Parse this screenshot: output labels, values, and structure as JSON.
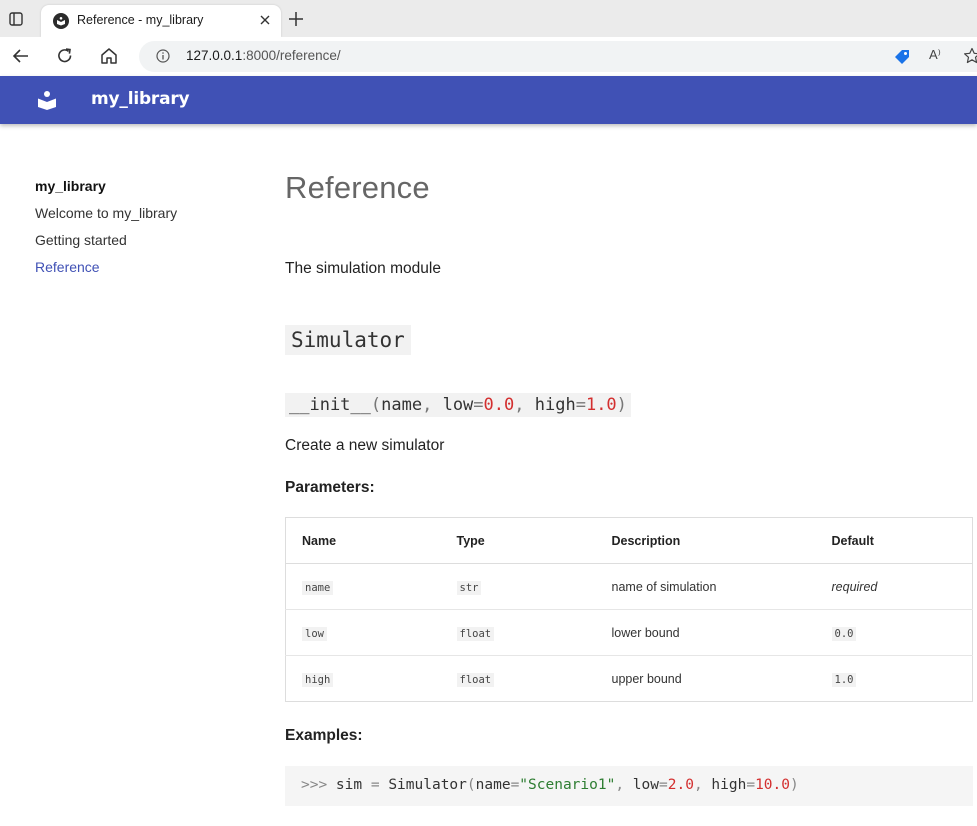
{
  "browser": {
    "tab_title": "Reference - my_library",
    "url_host": "127.0.0.1",
    "url_rest": ":8000/reference/",
    "read_aloud_label": "A⁾"
  },
  "site": {
    "brand": "my_library",
    "accent_color": "#4051b5"
  },
  "nav": {
    "title": "my_library",
    "items": [
      {
        "label": "Welcome to my_library",
        "active": false
      },
      {
        "label": "Getting started",
        "active": false
      },
      {
        "label": "Reference",
        "active": true
      }
    ]
  },
  "content": {
    "heading": "Reference",
    "lead": "The simulation module",
    "class_name": "Simulator",
    "signature": {
      "func": "__init__",
      "open": "(",
      "arg1": "name",
      "sep1": ", ",
      "arg2": "low",
      "eq": "=",
      "val2": "0.0",
      "sep2": ", ",
      "arg3": "high",
      "val3": "1.0",
      "close": ")"
    },
    "description": "Create a new simulator",
    "parameters_heading": "Parameters:",
    "table": {
      "headers": [
        "Name",
        "Type",
        "Description",
        "Default"
      ],
      "rows": [
        {
          "name": "name",
          "type": "str",
          "description": "name of simulation",
          "default": "required"
        },
        {
          "name": "low",
          "type": "float",
          "description": "lower bound",
          "default": "0.0"
        },
        {
          "name": "high",
          "type": "float",
          "description": "upper bound",
          "default": "1.0"
        }
      ]
    },
    "examples_heading": "Examples:",
    "example": {
      "prompt": ">>>",
      "var": " sim ",
      "eq": "=",
      "call": " Simulator",
      "open": "(",
      "k1": "name",
      "v1": "\"Scenario1\"",
      "sep": ", ",
      "k2": "low",
      "v2": "2.0",
      "k3": "high",
      "v3": "10.0",
      "close": ")"
    }
  }
}
